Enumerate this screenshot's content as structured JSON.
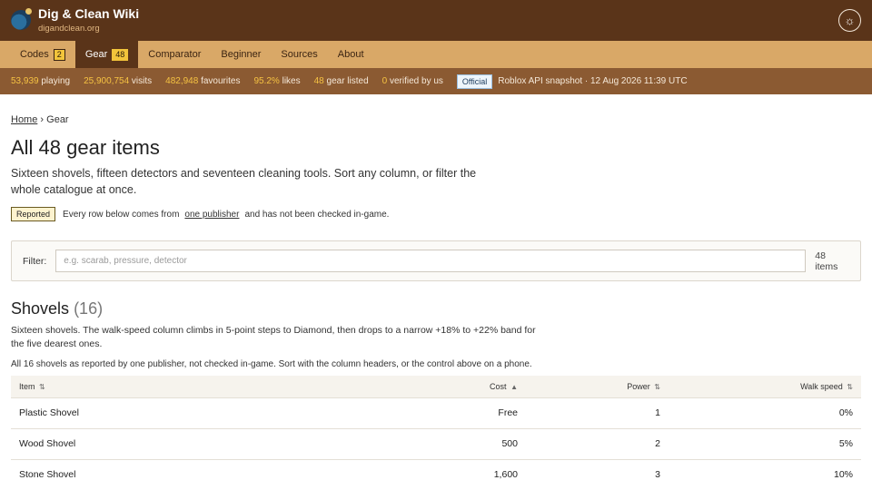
{
  "header": {
    "title": "Dig & Clean Wiki",
    "subtitle": "digandclean.org",
    "theme_icon": "sun-icon"
  },
  "nav": [
    {
      "label": "Codes",
      "badge": "2",
      "active": false
    },
    {
      "label": "Gear",
      "badge": "48",
      "active": true
    },
    {
      "label": "Comparator",
      "active": false
    },
    {
      "label": "Beginner",
      "active": false
    },
    {
      "label": "Sources",
      "active": false
    },
    {
      "label": "About",
      "active": false
    }
  ],
  "stats": {
    "playing": {
      "value": "53,939",
      "label": "playing"
    },
    "visits": {
      "value": "25,900,754",
      "label": "visits"
    },
    "favourites": {
      "value": "482,948",
      "label": "favourites"
    },
    "likes": {
      "value": "95.2%",
      "label": "likes"
    },
    "gear": {
      "value": "48",
      "label": "gear listed"
    },
    "verified": {
      "value": "0",
      "label": "verified by us"
    },
    "official_pill": "Official",
    "snapshot": "Roblox API snapshot · 12 Aug 2026 11:39 UTC"
  },
  "breadcrumb": {
    "home": "Home",
    "sep": "›",
    "current": "Gear"
  },
  "page": {
    "title": "All 48 gear items",
    "lead": "Sixteen shovels, fifteen detectors and seventeen cleaning tools. Sort any column, or filter the whole catalogue at once.",
    "notice_tag": "Reported",
    "notice_before": "Every row below comes from",
    "notice_link": "one publisher",
    "notice_after": "and has not been checked in-game."
  },
  "filter": {
    "label": "Filter:",
    "placeholder": "e.g. scarab, pressure, detector",
    "value": "",
    "count": "48 items"
  },
  "section": {
    "title": "Shovels",
    "count": "(16)",
    "lead": "Sixteen shovels. The walk-speed column climbs in 5-point steps to Diamond, then drops to a narrow +18% to +22% band for the five dearest ones.",
    "note": "All 16 shovels as reported by one publisher, not checked in-game. Sort with the column headers, or the control above on a phone."
  },
  "table": {
    "columns": [
      {
        "label": "Item",
        "sort": "⇅"
      },
      {
        "label": "Cost",
        "sort": "▲"
      },
      {
        "label": "Power",
        "sort": "⇅"
      },
      {
        "label": "Walk speed",
        "sort": "⇅"
      }
    ],
    "rows": [
      {
        "item": "Plastic Shovel",
        "cost": "Free",
        "power": "1",
        "walk": "0%"
      },
      {
        "item": "Wood Shovel",
        "cost": "500",
        "power": "2",
        "walk": "5%"
      },
      {
        "item": "Stone Shovel",
        "cost": "1,600",
        "power": "3",
        "walk": "10%"
      }
    ]
  }
}
